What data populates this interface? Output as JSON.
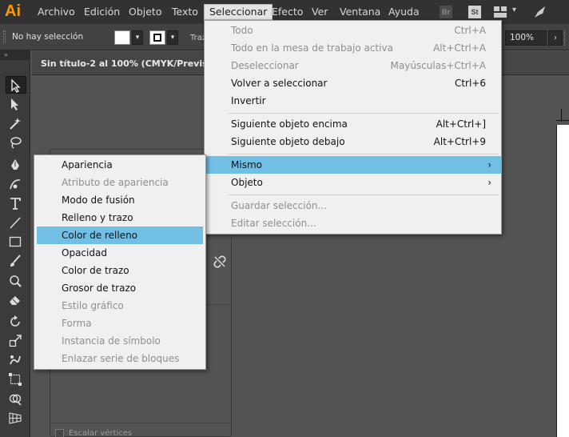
{
  "app": {
    "logo": "Ai"
  },
  "menubar": {
    "items": [
      "Archivo",
      "Edición",
      "Objeto",
      "Texto",
      "Seleccionar",
      "Efecto",
      "Ver",
      "Ventana",
      "Ayuda"
    ],
    "active": "Seleccionar",
    "icons": {
      "bridge": "Br",
      "stock": "St"
    }
  },
  "control_bar": {
    "selection_status": "No hay selección",
    "stroke_label": "Traz",
    "zoom": "100%"
  },
  "document": {
    "tab_title": "Sin título-2 al 100% (CMYK/Previsualiza"
  },
  "select_menu": {
    "items": [
      {
        "label": "Todo",
        "shortcut": "Ctrl+A",
        "disabled": true
      },
      {
        "label": "Todo en la mesa de trabajo activa",
        "shortcut": "Alt+Ctrl+A",
        "disabled": true
      },
      {
        "label": "Deseleccionar",
        "shortcut": "Mayúsculas+Ctrl+A",
        "disabled": true
      },
      {
        "label": "Volver a seleccionar",
        "shortcut": "Ctrl+6",
        "disabled": false
      },
      {
        "label": "Invertir",
        "shortcut": "",
        "disabled": false
      },
      {
        "label": "Siguiente objeto encima",
        "shortcut": "Alt+Ctrl+]",
        "disabled": false
      },
      {
        "label": "Siguiente objeto debajo",
        "shortcut": "Alt+Ctrl+9",
        "disabled": false
      },
      {
        "label": "Mismo",
        "shortcut": "",
        "disabled": false,
        "submenu": true,
        "highlighted": true
      },
      {
        "label": "Objeto",
        "shortcut": "",
        "disabled": false,
        "submenu": true
      },
      {
        "label": "Guardar selección...",
        "shortcut": "",
        "disabled": true
      },
      {
        "label": "Editar selección...",
        "shortcut": "",
        "disabled": true
      }
    ]
  },
  "same_submenu": {
    "items": [
      {
        "label": "Apariencia",
        "disabled": false
      },
      {
        "label": "Atributo de apariencia",
        "disabled": true
      },
      {
        "label": "Modo de fusión",
        "disabled": false
      },
      {
        "label": "Relleno y trazo",
        "disabled": false
      },
      {
        "label": "Color de relleno",
        "disabled": false,
        "highlighted": true
      },
      {
        "label": "Opacidad",
        "disabled": false
      },
      {
        "label": "Color de trazo",
        "disabled": false
      },
      {
        "label": "Grosor de trazo",
        "disabled": false
      },
      {
        "label": "Estilo gráfico",
        "disabled": true
      },
      {
        "label": "Forma",
        "disabled": true
      },
      {
        "label": "Instancia de símbolo",
        "disabled": true
      },
      {
        "label": "Enlazar serie de bloques",
        "disabled": true
      }
    ]
  },
  "panel": {
    "checkbox_label": "Escalar vértices"
  },
  "colors": {
    "menubar_bg": "#323232",
    "logo": "#ff9a00",
    "workspace_bg": "#535353",
    "menu_bg": "#f0f0f0",
    "highlight": "#72bfe6",
    "disabled_text": "#8e8e8e"
  }
}
